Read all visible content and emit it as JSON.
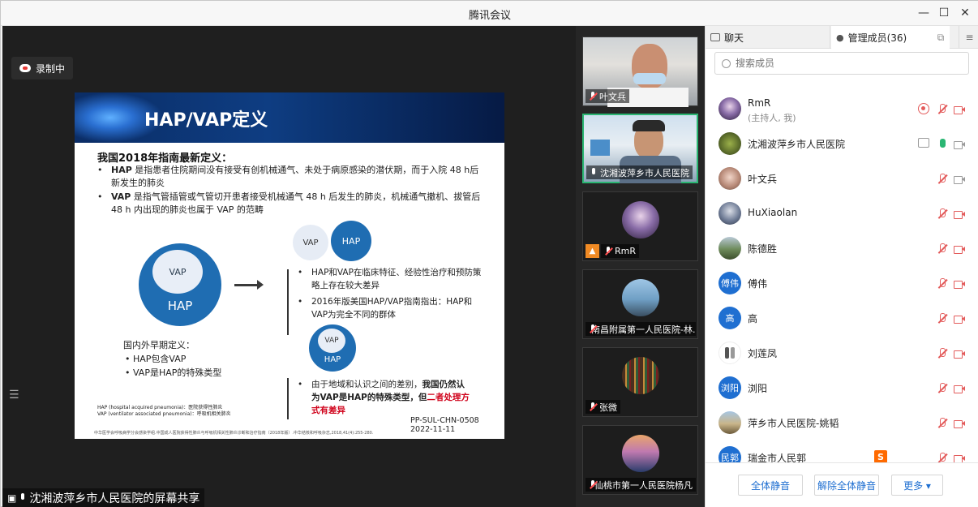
{
  "window": {
    "title": "腾讯会议"
  },
  "recording": {
    "label": "录制中"
  },
  "share_label": "沈湘波萍乡市人民医院的屏幕共享",
  "slide": {
    "title": "HAP/VAP定义",
    "subtitle": "我国2018年指南最新定义：",
    "bullets": [
      {
        "dot": "•",
        "bold": "HAP",
        "text": " 是指患者住院期间没有接受有创机械通气、未处于病原感染的潜伏期，而于入院 48 h后新发生的肺炎"
      },
      {
        "dot": "•",
        "bold": "VAP",
        "text": " 是指气管插管或气管切开患者接受机械通气 48 h 后发生的肺炎，机械通气撤机、拔管后 48 h 内出现的肺炎也属于 VAP 的范畴"
      }
    ],
    "big_inner": "VAP",
    "big_outer": "HAP",
    "small_grey": "VAP",
    "small_blue": "HAP",
    "right_bullets": [
      {
        "dot": "•",
        "text": "HAP和VAP在临床特征、经验性治疗和预防策略上存在较大差异"
      },
      {
        "dot": "•",
        "text": "2016年版美国HAP/VAP指南指出：HAP和VAP为完全不同的群体"
      }
    ],
    "mid_inner": "VAP",
    "mid_outer": "HAP",
    "last_bullet": {
      "dot": "•",
      "pre": "由于地域和认识之间的差别，",
      "bold": "我国仍然认为VAP是HAP的特殊类型，但",
      "red": "二者处理方式有差异"
    },
    "domestic_title": "国内外早期定义：",
    "domestic_items": [
      "•   HAP包含VAP",
      "•   VAP是HAP的特殊类型"
    ],
    "hap_note_1": "HAP  (hospital acquired pneumonia)：医院获得性肺炎",
    "hap_note_2": "VAP  (ventilator associated pneumonia)：呼吸机相关肺炎",
    "pp_code": "PP-SUL-CHN-0508",
    "pp_date": "2022-11-11",
    "footnote": "中华医学会呼吸病学分会感染学组.中国成人医院获得性肺炎与呼吸机相关性肺炎诊断和治疗指南（2018年版）.中华结核和呼吸杂志,2018,41(4):255-280."
  },
  "tiles": [
    {
      "name": "叶文兵"
    },
    {
      "name": "沈湘波萍乡市人民医院"
    },
    {
      "name": "RmR"
    },
    {
      "name": "南昌附属第一人民医院-林..."
    },
    {
      "name": "张微"
    },
    {
      "name": "仙桃市第一人民医院杨凡"
    }
  ],
  "panel": {
    "tab_chat": "聊天",
    "tab_members": "管理成员(36)",
    "search_placeholder": "搜索成员",
    "members": [
      {
        "name": "RmR",
        "sub": "(主持人, 我)",
        "avatar": ""
      },
      {
        "name": "沈湘波萍乡市人民医院",
        "avatar": ""
      },
      {
        "name": "叶文兵",
        "avatar": ""
      },
      {
        "name": "HuXiaolan",
        "avatar": ""
      },
      {
        "name": "陈德胜",
        "avatar": ""
      },
      {
        "name": "傅伟",
        "avatar": "傅伟"
      },
      {
        "name": "高",
        "avatar": "高"
      },
      {
        "name": "刘莲凤",
        "avatar": ""
      },
      {
        "name": "浏阳",
        "avatar": "浏阳"
      },
      {
        "name": "萍乡市人民医院-姚韬",
        "avatar": ""
      },
      {
        "name": "瑞金市人民郭",
        "avatar": "民郭"
      }
    ],
    "btn_mute_all": "全体静音",
    "btn_unmute_all": "解除全体静音",
    "btn_more": "更多 ▾",
    "sogou": "S"
  },
  "colors": {
    "accent": "#1f6fd1",
    "active_tile": "#2bb673",
    "muted": "#e35b5b",
    "slide_blue": "#1f6db2"
  }
}
